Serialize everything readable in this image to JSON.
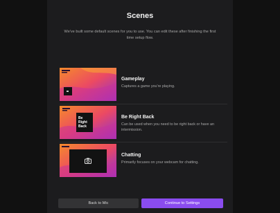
{
  "header": {
    "title": "Scenes",
    "subtitle": "We've built some default scenes for you to use. You can edit these after finishing the first time setup flow."
  },
  "scenes": [
    {
      "name": "Gameplay",
      "description": "Captures a game you're playing.",
      "thumbnail_icon": "gameplay-layout-icon"
    },
    {
      "name": "Be Right Back",
      "description": "Can be used when you need to be right back or have an intermission.",
      "thumbnail_label": "Be Right Back"
    },
    {
      "name": "Chatting",
      "description": "Primarily focuses on your webcam for chatting.",
      "thumbnail_icon": "camera-icon"
    }
  ],
  "footer": {
    "back_label": "Back to Mic",
    "continue_label": "Continue to Settings"
  },
  "colors": {
    "accent": "#8a4cef",
    "thumb_orange": "#f47a2a",
    "thumb_pink": "#e83a6a",
    "thumb_purple": "#7a2bd6"
  }
}
